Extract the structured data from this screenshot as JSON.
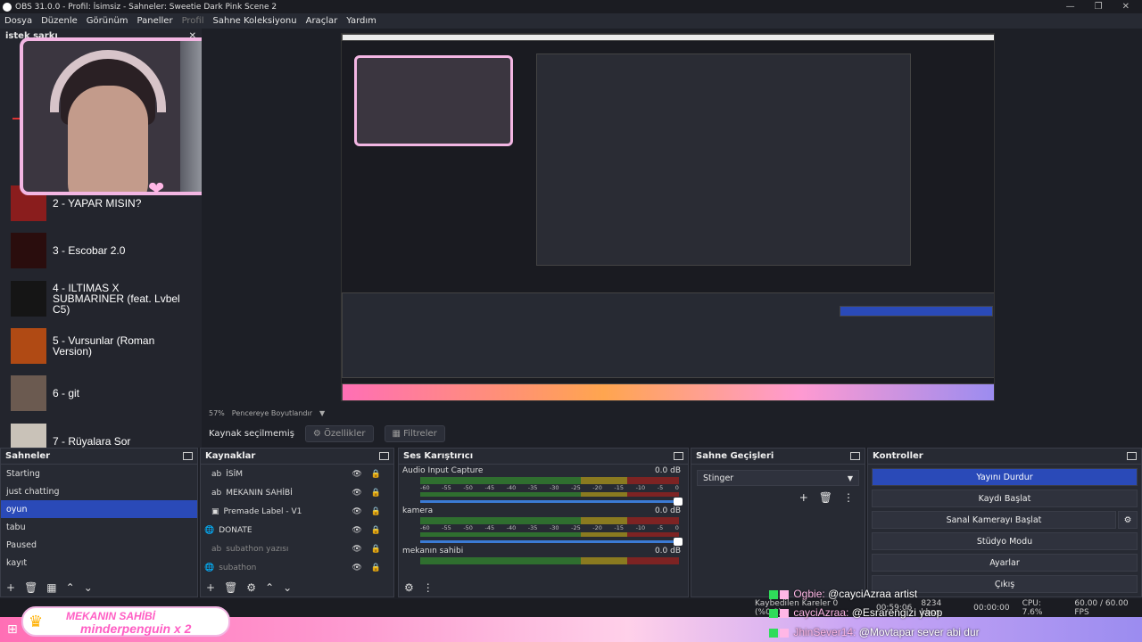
{
  "window": {
    "title": "OBS 31.0.0 - Profil: İsimsiz - Sahneler: Sweetie Dark Pink Scene 2"
  },
  "menu": [
    "Dosya",
    "Düzenle",
    "Görünüm",
    "Paneller",
    "Profil",
    "Sahne Koleksiyonu",
    "Araçlar",
    "Yardım"
  ],
  "left_dock": {
    "title": "istek şarkı",
    "songs": [
      "2 - YAPAR MISIN?",
      "3 - Escobar 2.0",
      "4 - ILTIMAS X SUBMARINER (feat. Lvbel C5)",
      "5 - Vursunlar (Roman Version)",
      "6 - git",
      "7 - Rüyalara Sor"
    ]
  },
  "preview": {
    "zoom": "57%",
    "fit_label": "Pencereye Boyutlandır"
  },
  "propbar": {
    "no_source": "Kaynak seçilmemiş",
    "properties": "Özellikler",
    "filters": "Filtreler"
  },
  "scenes": {
    "title": "Sahneler",
    "items": [
      "Starting",
      "just chatting",
      "oyun",
      "tabu",
      "Paused",
      "kayıt"
    ],
    "selected": "oyun"
  },
  "sources": {
    "title": "Kaynaklar",
    "items": [
      {
        "name": "İSİM",
        "type": "text"
      },
      {
        "name": "MEKANIN SAHİBİ",
        "type": "text"
      },
      {
        "name": "Premade Label - V1",
        "type": "image"
      },
      {
        "name": "DONATE",
        "type": "browser"
      },
      {
        "name": "subathon yazısı",
        "type": "text"
      },
      {
        "name": "subathon",
        "type": "browser"
      }
    ]
  },
  "mixer": {
    "title": "Ses Karıştırıcı",
    "channels": [
      {
        "name": "Audio Input Capture",
        "db": "0.0 dB"
      },
      {
        "name": "kamera",
        "db": "0.0 dB"
      },
      {
        "name": "mekanın sahibi",
        "db": "0.0 dB"
      }
    ],
    "ticks": [
      "-60",
      "-55",
      "-50",
      "-45",
      "-40",
      "-35",
      "-30",
      "-25",
      "-20",
      "-15",
      "-10",
      "-5",
      "0"
    ]
  },
  "transitions": {
    "title": "Sahne Geçişleri",
    "selected": "Stinger"
  },
  "controls": {
    "title": "Kontroller",
    "stop_stream": "Yayını Durdur",
    "start_record": "Kaydı Başlat",
    "virtual_cam": "Sanal Kamerayı Başlat",
    "studio": "Stüdyo Modu",
    "settings": "Ayarlar",
    "exit": "Çıkış"
  },
  "status": {
    "dropped": "Kaybedilen Kareler 0 (%0.0)",
    "stream_time": "00:59:06",
    "bitrate": "8234 kbps",
    "rec_time": "00:00:00",
    "cpu": "CPU: 7.6%",
    "fps": "60.00 / 60.00 FPS"
  },
  "banner": {
    "line1": "MEKANIN SAHİBİ",
    "line2": "minderpenguin x 2"
  },
  "chat": [
    {
      "user": "Ogbie:",
      "msg": "@cayciAzraa artist"
    },
    {
      "user": "cayciAzraa:",
      "msg": "@Esrarengizi yaop"
    },
    {
      "user": "JhinSever14:",
      "msg": "@Movtapar sever abi dur"
    }
  ],
  "colors": {
    "accent": "#2a4ab8",
    "pink": "#f3b6e3",
    "panel": "#272a33"
  }
}
